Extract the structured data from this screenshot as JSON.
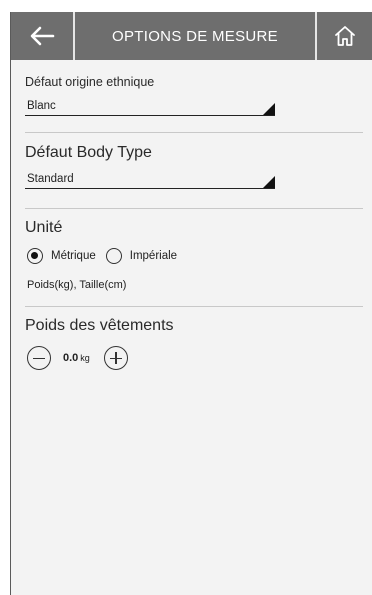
{
  "header": {
    "title": "OPTIONS DE MESURE",
    "back_icon": "arrow-left-icon",
    "home_icon": "home-icon"
  },
  "ethnicity": {
    "label": "Défaut origine ethnique",
    "value": "Blanc"
  },
  "body_type": {
    "label": "Défaut Body Type",
    "value": "Standard"
  },
  "unit": {
    "label": "Unité",
    "options": [
      "Métrique",
      "Impériale"
    ],
    "selected": "Métrique",
    "hint": "Poids(kg), Taille(cm)"
  },
  "clothing_weight": {
    "label": "Poids des vêtements",
    "value": "0.0",
    "unit": "kg"
  },
  "colors": {
    "header_bg": "#6e6e6e",
    "panel_bg": "#f3f3f3",
    "text": "#222222"
  }
}
